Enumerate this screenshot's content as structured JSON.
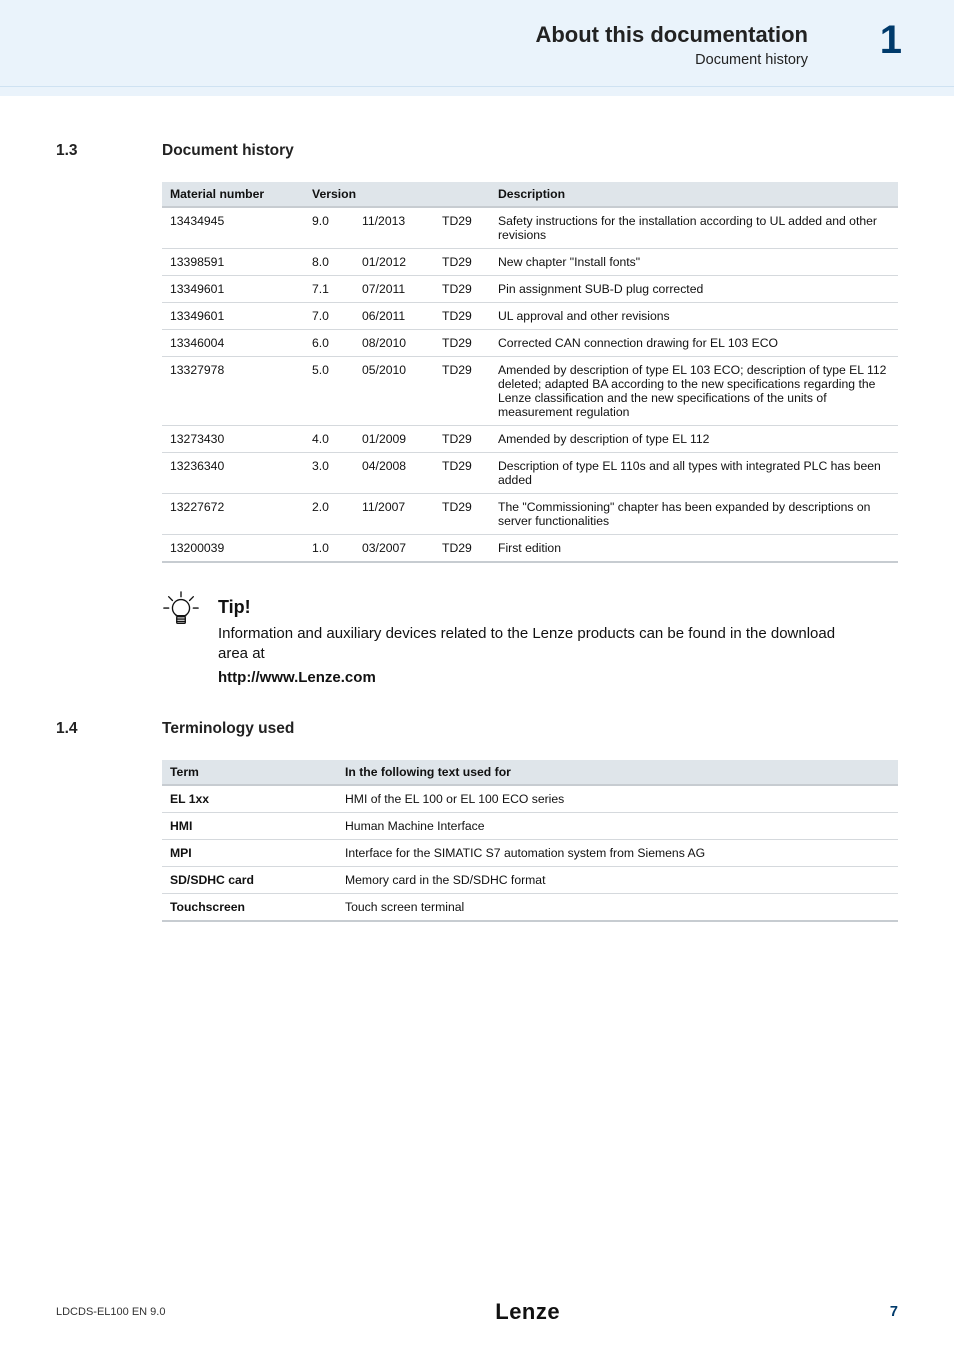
{
  "header": {
    "title": "About this documentation",
    "subtitle": "Document history",
    "chapter": "1"
  },
  "sec1": {
    "num": "1.3",
    "title": "Document history"
  },
  "table1": {
    "h": {
      "mat": "Material number",
      "ver": "Version",
      "desc": "Description"
    },
    "rows": [
      {
        "mat": "13434945",
        "v": "9.0",
        "d": "11/2013",
        "c": "TD29",
        "desc": "Safety instructions for the installation according to UL added and other revisions"
      },
      {
        "mat": "13398591",
        "v": "8.0",
        "d": "01/2012",
        "c": "TD29",
        "desc": "New chapter \"Install fonts\""
      },
      {
        "mat": "13349601",
        "v": "7.1",
        "d": "07/2011",
        "c": "TD29",
        "desc": "Pin assignment SUB-D plug corrected"
      },
      {
        "mat": "13349601",
        "v": "7.0",
        "d": "06/2011",
        "c": "TD29",
        "desc": "UL approval and other revisions"
      },
      {
        "mat": "13346004",
        "v": "6.0",
        "d": "08/2010",
        "c": "TD29",
        "desc": "Corrected CAN connection drawing for EL 103 ECO"
      },
      {
        "mat": "13327978",
        "v": "5.0",
        "d": "05/2010",
        "c": "TD29",
        "desc": "Amended by description of type EL 103 ECO; description of type EL 112 deleted; adapted BA according to the new specifications regarding the Lenze classification and the new specifications of the units of measurement regulation"
      },
      {
        "mat": "13273430",
        "v": "4.0",
        "d": "01/2009",
        "c": "TD29",
        "desc": "Amended by description of type EL 112"
      },
      {
        "mat": "13236340",
        "v": "3.0",
        "d": "04/2008",
        "c": "TD29",
        "desc": "Description of type EL 110s and all types with integrated PLC has been added"
      },
      {
        "mat": "13227672",
        "v": "2.0",
        "d": "11/2007",
        "c": "TD29",
        "desc": "The \"Commissioning\" chapter has been expanded by descriptions on server functionalities"
      },
      {
        "mat": "13200039",
        "v": "1.0",
        "d": "03/2007",
        "c": "TD29",
        "desc": "First edition"
      }
    ]
  },
  "tip": {
    "title": "Tip!",
    "body": "Information and auxiliary devices related to the Lenze products can be found in the download area at",
    "link": "http://www.Lenze.com"
  },
  "sec2": {
    "num": "1.4",
    "title": "Terminology used"
  },
  "table2": {
    "h": {
      "term": "Term",
      "desc": "In the following text used for"
    },
    "rows": [
      {
        "term": "EL 1xx",
        "desc": "HMI of the EL 100 or EL 100 ECO series"
      },
      {
        "term": "HMI",
        "desc": "Human Machine Interface"
      },
      {
        "term": "MPI",
        "desc": "Interface for the SIMATIC S7 automation system from Siemens AG"
      },
      {
        "term": "SD/SDHC card",
        "desc": "Memory card in the SD/SDHC format"
      },
      {
        "term": "Touchscreen",
        "desc": "Touch screen terminal"
      }
    ]
  },
  "footer": {
    "doc_id": "LDCDS-EL100  EN  9.0",
    "brand": "Lenze",
    "page": "7"
  }
}
